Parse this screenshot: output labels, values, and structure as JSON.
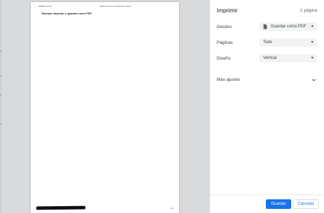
{
  "print_dialog": {
    "title": "Imprimir",
    "sheet_count": "1 página",
    "destination_label": "Destino",
    "destination_value": "Guardar como PDF",
    "pages_label": "Páginas",
    "pages_value": "Todo",
    "layout_label": "Diseño",
    "layout_value": "Vertical",
    "more_settings_label": "Más ajustes",
    "save_label": "Guardar",
    "cancel_label": "Cancelar"
  },
  "preview": {
    "header_datetime": "19/8/22, 13:40",
    "header_title": "Editor de texto enriquecido, editor1",
    "heading": "Ejemplo imprimir o guardar como PDF",
    "page_number": "1/1"
  },
  "icons": {
    "destination_icon": "pdf-file-icon",
    "more_settings_icon": "chevron-down-icon"
  },
  "colors": {
    "accent": "#1a73e8",
    "preview_background": "#d9dadc",
    "select_background": "#f1f3f4"
  }
}
